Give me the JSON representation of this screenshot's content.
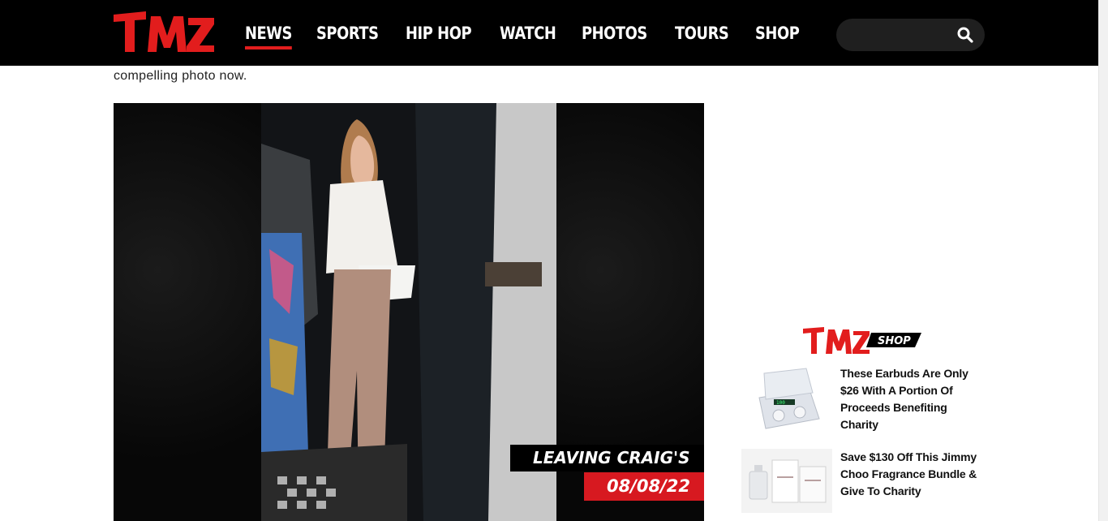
{
  "header": {
    "nav": [
      {
        "label": "NEWS",
        "active": true
      },
      {
        "label": "SPORTS",
        "active": false
      },
      {
        "label": "HIP HOP",
        "active": false
      },
      {
        "label": "WATCH",
        "active": false
      },
      {
        "label": "PHOTOS",
        "active": false
      },
      {
        "label": "TOURS",
        "active": false
      },
      {
        "label": "SHOP",
        "active": false
      }
    ],
    "search_placeholder": "",
    "accent_color": "#e21d1d"
  },
  "article": {
    "paragraph_tail": "compelling photo now.",
    "photo": {
      "tag_line1": "LEAVING CRAIG'S",
      "tag_line2": "08/08/22"
    }
  },
  "sidebar": {
    "shop_items": [
      {
        "title": "These Earbuds Are Only $26 With A Portion Of Proceeds Benefiting Charity",
        "icon": "earbuds-product-image"
      },
      {
        "title": "Save $130 Off This Jimmy Choo Fragrance Bundle & Give To Charity",
        "icon": "fragrance-product-image"
      }
    ]
  }
}
